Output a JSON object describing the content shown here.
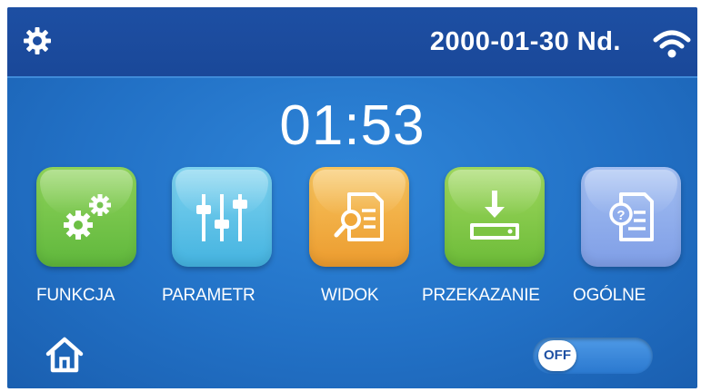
{
  "header": {
    "date": "2000-01-30 Nd.",
    "settings_icon": "gear-icon",
    "wifi_icon": "wifi-icon"
  },
  "clock": {
    "time": "01:53"
  },
  "menu": {
    "items": [
      {
        "label": "FUNKCJA",
        "icon": "gears-icon",
        "color": "#6cbf44"
      },
      {
        "label": "PARAMETR",
        "icon": "sliders-icon",
        "color": "#55bde6"
      },
      {
        "label": "WIDOK",
        "icon": "document-search-icon",
        "color": "#f0a83a"
      },
      {
        "label": "PRZEKAZANIE",
        "icon": "download-icon",
        "color": "#7cc443"
      },
      {
        "label": "OGÓLNE",
        "icon": "document-help-icon",
        "color": "#8eacec"
      }
    ]
  },
  "footer": {
    "home_icon": "home-icon",
    "toggle_label": "OFF",
    "toggle_state": "off"
  },
  "colors": {
    "background": "#2271c6",
    "topbar": "#1d4fa3",
    "text": "#ffffff"
  }
}
